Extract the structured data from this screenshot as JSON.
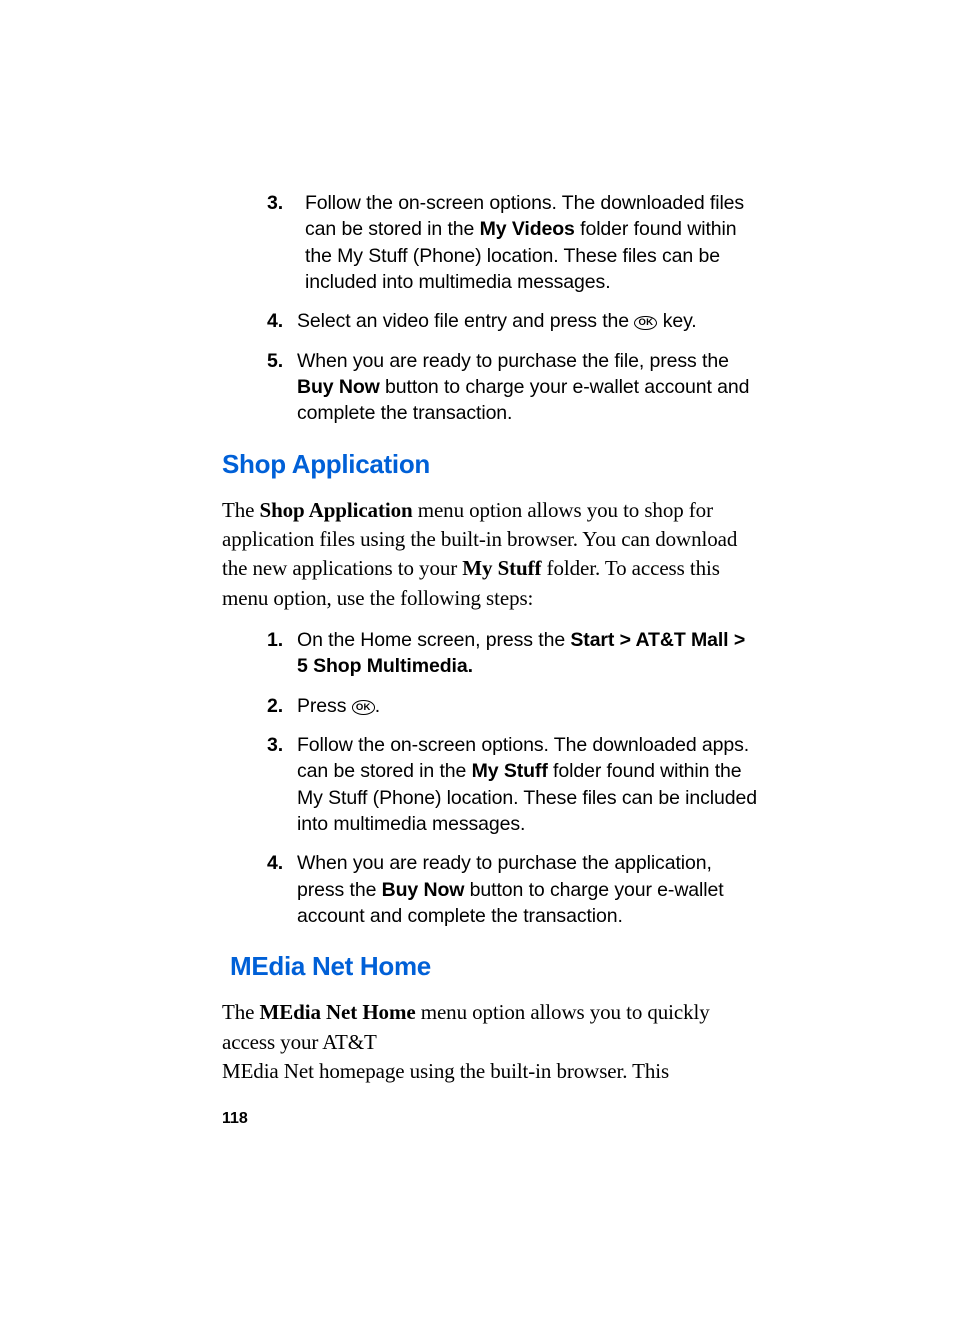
{
  "topList": [
    {
      "num": "3.",
      "segments": [
        {
          "t": " Follow the on-screen options. The downloaded files can be stored in the "
        },
        {
          "t": "My Videos",
          "b": true
        },
        {
          "t": " folder found within the My Stuff (Phone) location. These files can be included into multimedia messages."
        }
      ]
    },
    {
      "num": "4.",
      "segments": [
        {
          "t": "Select an video file entry and press the "
        },
        {
          "ok": true
        },
        {
          "t": " key."
        }
      ]
    },
    {
      "num": "5.",
      "segments": [
        {
          "t": "When you are ready to purchase the file, press the "
        },
        {
          "t": "Buy Now",
          "b": true
        },
        {
          "t": " button to charge your e-wallet account and complete the transaction."
        }
      ]
    }
  ],
  "heading1": "Shop Application",
  "para1": {
    "segments": [
      {
        "t": "The "
      },
      {
        "t": "Shop Application",
        "b": true
      },
      {
        "t": " menu option allows you to shop for application files using the built-in browser. You can download the new applications to your "
      },
      {
        "t": "My Stuff",
        "b": true
      },
      {
        "t": " folder. To access this menu option, use the following steps:"
      }
    ]
  },
  "midList": [
    {
      "num": "1.",
      "segments": [
        {
          "t": "On the Home screen, press the "
        },
        {
          "t": "Start > AT&T Mall > 5 Shop Multimedia.",
          "b": true
        }
      ]
    },
    {
      "num": "2.",
      "segments": [
        {
          "t": "Press "
        },
        {
          "ok": true
        },
        {
          "t": "."
        }
      ]
    },
    {
      "num": "3.",
      "segments": [
        {
          "t": "Follow the on-screen options. The downloaded apps. can be stored in the "
        },
        {
          "t": "My Stuff",
          "b": true
        },
        {
          "t": " folder found within the My Stuff (Phone) location. These files can be included into multimedia messages."
        }
      ]
    },
    {
      "num": "4.",
      "segments": [
        {
          "t": "When you are ready to purchase the application, press the "
        },
        {
          "t": "Buy Now",
          "b": true
        },
        {
          "t": " button to charge your e-wallet account and complete the transaction."
        }
      ]
    }
  ],
  "heading2": " MEdia Net Home",
  "para2": {
    "segments": [
      {
        "t": "The "
      },
      {
        "t": "MEdia Net Home",
        "b": true
      },
      {
        "t": " menu option allows you to quickly access your AT&T"
      },
      {
        "br": true
      },
      {
        "t": "MEdia Net homepage using the built-in browser. This"
      }
    ]
  },
  "okLabel": "OK",
  "pageNumber": "118"
}
